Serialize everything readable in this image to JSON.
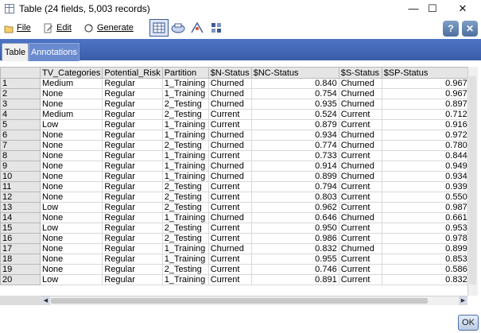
{
  "window": {
    "title": "Table (24 fields, 5,003 records)",
    "minimize": "—",
    "maximize": "☐",
    "close": "✕"
  },
  "menu": {
    "file": "File",
    "edit": "Edit",
    "generate": "Generate"
  },
  "toolbar_icons": [
    "table-view-icon",
    "print-icon",
    "export-icon",
    "options-icon"
  ],
  "help_glyph": "?",
  "close_glyph": "✕",
  "tabs": {
    "table": "Table",
    "annotations": "Annotations"
  },
  "table": {
    "columns": [
      "",
      "TV_Categories",
      "Potential_Risk",
      "Partition",
      "$N-Status",
      "$NC-Status",
      "$S-Status",
      "$SP-Status"
    ],
    "rows": [
      [
        "1",
        "Medium",
        "Regular",
        "1_Training",
        "Churned",
        "0.840",
        "Churned",
        "0.967"
      ],
      [
        "2",
        "None",
        "Regular",
        "1_Training",
        "Churned",
        "0.754",
        "Churned",
        "0.967"
      ],
      [
        "3",
        "None",
        "Regular",
        "2_Testing",
        "Churned",
        "0.935",
        "Churned",
        "0.897"
      ],
      [
        "4",
        "Medium",
        "Regular",
        "2_Testing",
        "Current",
        "0.524",
        "Current",
        "0.712"
      ],
      [
        "5",
        "Low",
        "Regular",
        "1_Training",
        "Current",
        "0.879",
        "Current",
        "0.916"
      ],
      [
        "6",
        "None",
        "Regular",
        "1_Training",
        "Churned",
        "0.934",
        "Churned",
        "0.972"
      ],
      [
        "7",
        "None",
        "Regular",
        "2_Testing",
        "Churned",
        "0.774",
        "Churned",
        "0.780"
      ],
      [
        "8",
        "None",
        "Regular",
        "1_Training",
        "Current",
        "0.733",
        "Current",
        "0.844"
      ],
      [
        "9",
        "None",
        "Regular",
        "1_Training",
        "Churned",
        "0.914",
        "Churned",
        "0.949"
      ],
      [
        "10",
        "None",
        "Regular",
        "1_Training",
        "Churned",
        "0.899",
        "Churned",
        "0.934"
      ],
      [
        "11",
        "None",
        "Regular",
        "2_Testing",
        "Current",
        "0.794",
        "Current",
        "0.939"
      ],
      [
        "12",
        "None",
        "Regular",
        "2_Testing",
        "Current",
        "0.803",
        "Current",
        "0.550"
      ],
      [
        "13",
        "Low",
        "Regular",
        "2_Testing",
        "Current",
        "0.962",
        "Current",
        "0.987"
      ],
      [
        "14",
        "None",
        "Regular",
        "1_Training",
        "Churned",
        "0.646",
        "Churned",
        "0.661"
      ],
      [
        "15",
        "Low",
        "Regular",
        "2_Testing",
        "Current",
        "0.950",
        "Current",
        "0.953"
      ],
      [
        "16",
        "None",
        "Regular",
        "2_Testing",
        "Current",
        "0.986",
        "Current",
        "0.978"
      ],
      [
        "17",
        "None",
        "Regular",
        "1_Training",
        "Churned",
        "0.832",
        "Churned",
        "0.899"
      ],
      [
        "18",
        "None",
        "Regular",
        "1_Training",
        "Current",
        "0.955",
        "Current",
        "0.853"
      ],
      [
        "19",
        "None",
        "Regular",
        "2_Testing",
        "Current",
        "0.746",
        "Current",
        "0.586"
      ],
      [
        "20",
        "Low",
        "Regular",
        "1_Training",
        "Current",
        "0.891",
        "Current",
        "0.832"
      ]
    ]
  },
  "ok_label": "OK",
  "colors": {
    "tab_strip": "#3f63ad",
    "header_bg": "#e5e5e5",
    "ok_border": "#4b6ea8"
  }
}
